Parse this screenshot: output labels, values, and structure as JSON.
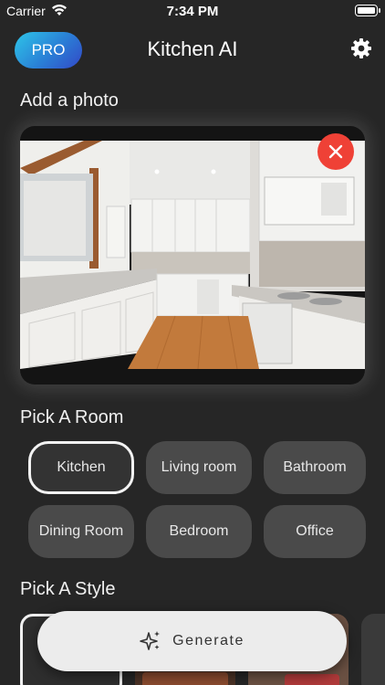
{
  "status_bar": {
    "carrier": "Carrier",
    "time": "7:34 PM"
  },
  "header": {
    "pro_label": "PRO",
    "title": "Kitchen AI"
  },
  "add_photo": {
    "title": "Add a photo"
  },
  "rooms": {
    "title": "Pick A Room",
    "items": [
      {
        "label": "Kitchen",
        "selected": true
      },
      {
        "label": "Living room",
        "selected": false
      },
      {
        "label": "Bathroom",
        "selected": false
      },
      {
        "label": "Dining Room",
        "selected": false
      },
      {
        "label": "Bedroom",
        "selected": false
      },
      {
        "label": "Office",
        "selected": false
      }
    ]
  },
  "styles": {
    "title": "Pick A Style"
  },
  "generate": {
    "label": "Generate"
  },
  "colors": {
    "accent_gradient": [
      "#2ec5e8",
      "#3348c7"
    ],
    "remove": "#ef4136",
    "background": "#262626"
  }
}
